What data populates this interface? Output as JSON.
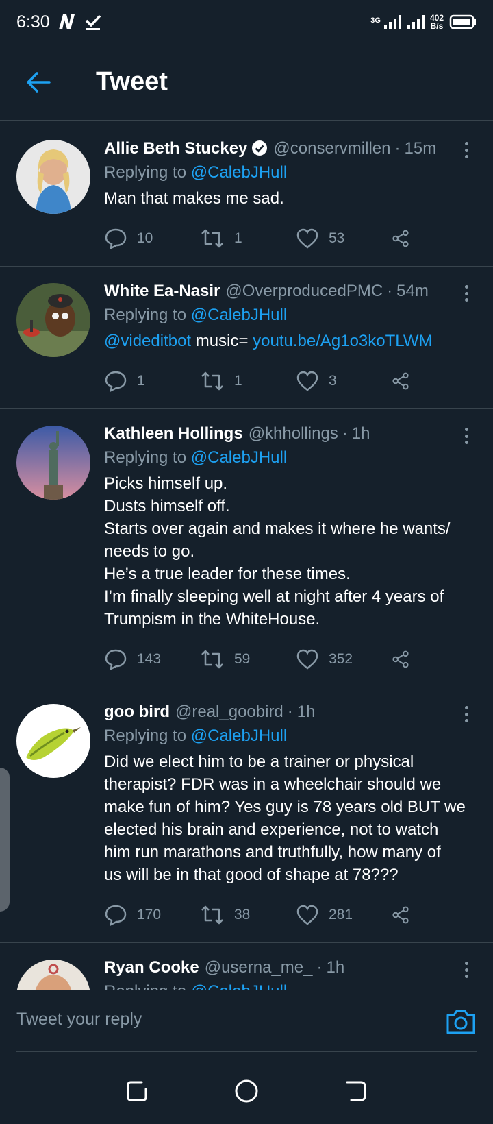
{
  "status_bar": {
    "time": "6:30",
    "net_type": "3G",
    "net_speed_value": "402",
    "net_speed_unit": "B/s"
  },
  "header": {
    "title": "Tweet"
  },
  "tweets": [
    {
      "name": "Allie Beth Stuckey",
      "verified": true,
      "handle": "@conservmillen",
      "time": "15m",
      "replying_label": "Replying to",
      "replying_to": "@CalebJHull",
      "text": "Man that makes me sad.",
      "replies": "10",
      "retweets": "1",
      "likes": "53"
    },
    {
      "name": "White Ea-Nasir",
      "handle": "@OverproducedPMC",
      "time": "54m",
      "replying_label": "Replying to",
      "replying_to": "@CalebJHull",
      "text_mention": "@videditbot",
      "text_mid": " music= ",
      "text_link": "youtu.be/Ag1o3koTLWM",
      "replies": "1",
      "retweets": "1",
      "likes": "3"
    },
    {
      "name": "Kathleen Hollings",
      "handle": "@khhollings",
      "time": "1h",
      "replying_label": "Replying to",
      "replying_to": "@CalebJHull",
      "text": "Picks himself up.\nDusts himself off.\nStarts over again and makes it where he wants/\nneeds to go.\nHe’s a true leader for these times.\nI’m finally sleeping well at night after 4 years of\nTrumpism in the WhiteHouse.",
      "replies": "143",
      "retweets": "59",
      "likes": "352"
    },
    {
      "name": "goo bird",
      "handle": "@real_goobird",
      "time": "1h",
      "replying_label": "Replying to",
      "replying_to": "@CalebJHull",
      "text": "Did we elect him to be a trainer or physical\ntherapist? FDR was in a wheelchair should we\nmake fun of him? Yes guy is 78 years old BUT we\nelected his brain and experience, not to watch\nhim run marathons and truthfully, how many of\nus will be in that good of shape at 78???",
      "replies": "170",
      "retweets": "38",
      "likes": "281"
    },
    {
      "name": "Ryan Cooke",
      "handle": "@userna_me_",
      "time": "1h",
      "replying_label": "Replying to",
      "replying_to": "@CalebJHull"
    }
  ],
  "reply_bar": {
    "placeholder": "Tweet your reply"
  },
  "colors": {
    "background": "#15202b",
    "accent": "#1da1f2",
    "secondary_text": "#8899a6",
    "divider": "#38444d"
  },
  "icons": [
    "arrow-left-icon",
    "verified-badge-icon",
    "more-vertical-icon",
    "reply-icon",
    "retweet-icon",
    "like-icon",
    "share-icon",
    "camera-icon",
    "recent-apps-icon",
    "home-icon",
    "back-nav-icon"
  ]
}
